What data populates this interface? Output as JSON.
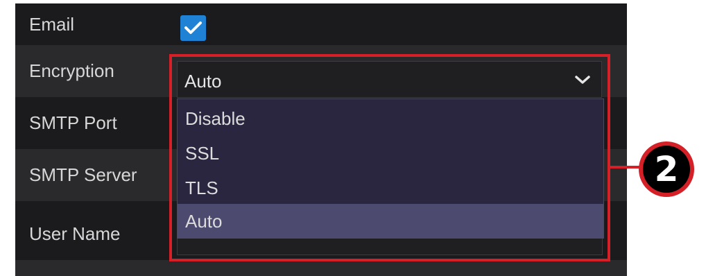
{
  "settings": {
    "rows": [
      {
        "label": "Email"
      },
      {
        "label": "Encryption"
      },
      {
        "label": "SMTP Port"
      },
      {
        "label": "SMTP Server"
      },
      {
        "label": "User Name"
      }
    ],
    "email_enabled": true,
    "encryption": {
      "selected": "Auto",
      "options": [
        "Disable",
        "SSL",
        "TLS",
        "Auto"
      ]
    }
  },
  "callout": {
    "number": "2",
    "color": "#d42026"
  },
  "icons": {
    "checkbox": "checkmark-icon",
    "dropdown": "chevron-down-icon"
  },
  "colors": {
    "checkbox": "#1f82d4",
    "selected_option": "#4c4a6e",
    "dropdown_bg": "#2a2640",
    "panel_bg": "#1b1b1d"
  }
}
